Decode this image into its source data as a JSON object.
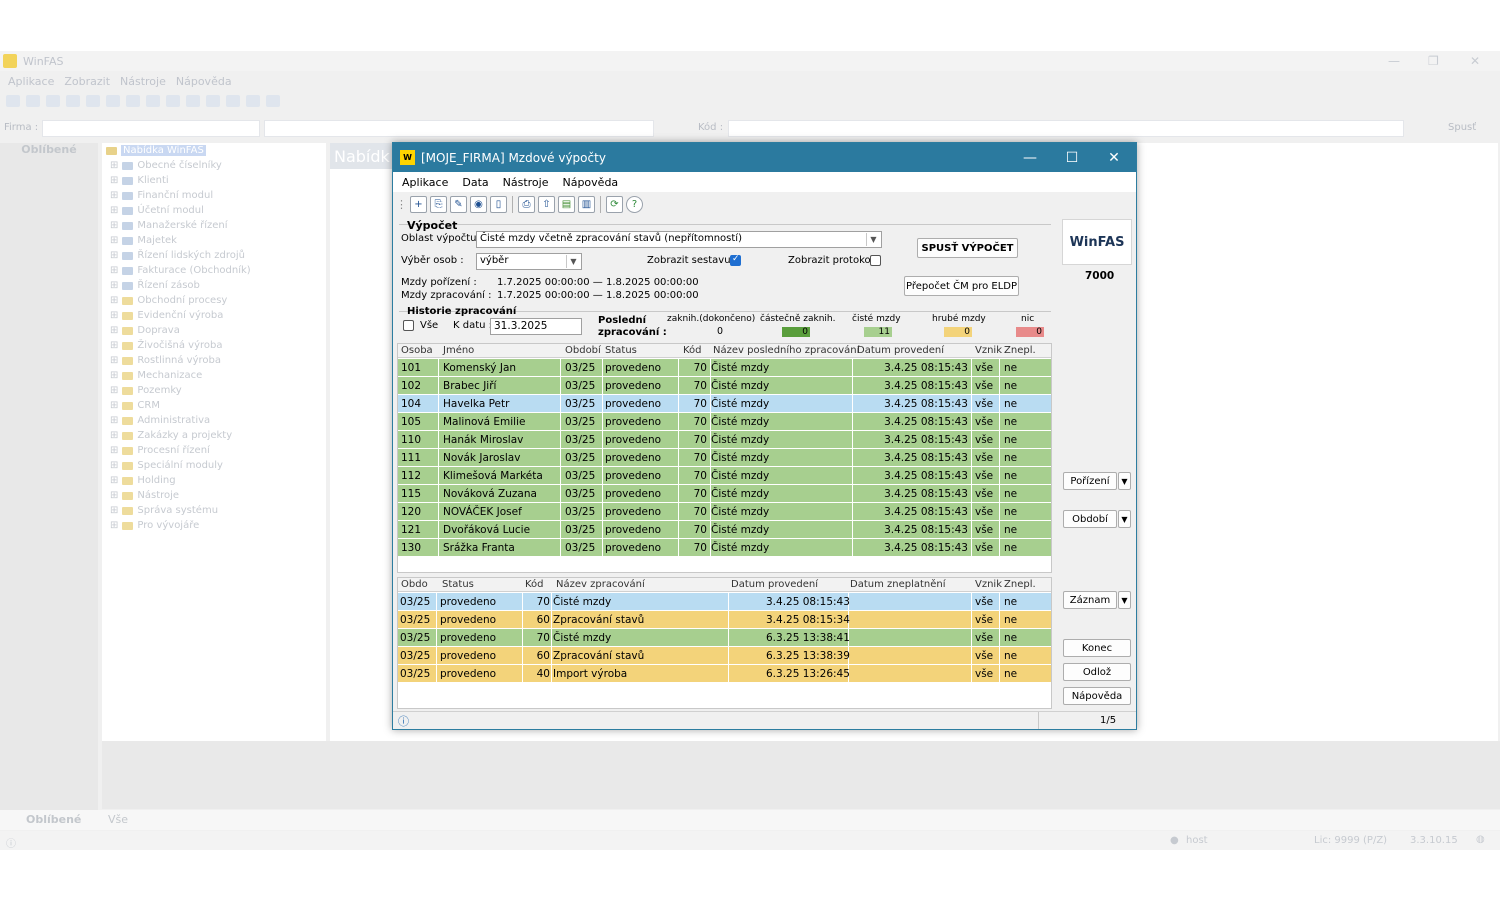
{
  "bg": {
    "title": "WinFAS",
    "menu": [
      "Aplikace",
      "Zobrazit",
      "Nástroje",
      "Nápověda"
    ],
    "firma_label": "Firma :",
    "kod_label": "Kód :",
    "spust": "Spusť",
    "left_tab": "Oblíbené",
    "main_tab": "Nabídk",
    "tree_root": "Nabídka WinFAS",
    "tree_items": [
      "Obecné číselníky",
      "Klienti",
      "Finanční modul",
      "Účetní modul",
      "Manažerské řízení",
      "Majetek",
      "Řízení lidských zdrojů",
      "Fakturace (Obchodník)",
      "Řízení zásob",
      "Obchodní procesy",
      "Evidenční výroba",
      "Doprava",
      "Živočišná výroba",
      "Rostlinná výroba",
      "Mechanizace",
      "Pozemky",
      "CRM",
      "Administrativa",
      "Zakázky a projekty",
      "Procesní řízení",
      "Speciální moduly",
      "Holding",
      "Nástroje",
      "Správa systému",
      "Pro vývojáře"
    ],
    "bottom_tab1": "Oblíbené",
    "bottom_tab2": "Vše",
    "status_user": "host",
    "status_lic": "Lic: 9999 (P/Z)",
    "status_ver": "3.3.10.15"
  },
  "dialog": {
    "title": "[MOJE_FIRMA] Mzdové výpočty",
    "menu": [
      "Aplikace",
      "Data",
      "Nástroje",
      "Nápověda"
    ],
    "vypocet": {
      "group": "Výpočet",
      "oblast_label": "Oblast výpočtu",
      "oblast_value": "Čisté mzdy včetně zpracování stavů (nepřítomností)",
      "vyber_label": "Výběr osob :",
      "vyber_value": "výběr",
      "sestava_label": "Zobrazit sestavu :",
      "protokol_label": "Zobrazit protokol :",
      "porizeni_label": "Mzdy pořízení :",
      "porizeni_value": "1.7.2025 00:00:00  —  1.8.2025 00:00:00",
      "zprac_label": "Mzdy zpracování :",
      "zprac_value": "1.7.2025 00:00:00  —  1.8.2025 00:00:00",
      "spust_btn": "SPUSŤ VÝPOČET",
      "prepocet_btn": "Přepočet ČM pro ELDP"
    },
    "historie": {
      "group": "Historie zpracování",
      "vse": "Vše",
      "kdatu_label": "K datu :",
      "kdatu_value": "31.3.2025",
      "posledni": "Poslední",
      "zpracovani": "zpracování :",
      "stats": [
        {
          "label": "zaknih.(dokončeno)",
          "value": "0",
          "color": "#f0f0f0"
        },
        {
          "label": "částečně zaknih.",
          "value": "0",
          "color": "#5a9e3c"
        },
        {
          "label": "čisté mzdy",
          "value": "11",
          "color": "#a7cf8f"
        },
        {
          "label": "hrubé mzdy",
          "value": "0",
          "color": "#f3d37a"
        },
        {
          "label": "nic",
          "value": "0",
          "color": "#e88a8a"
        }
      ]
    },
    "grid1": {
      "headers": [
        "Osoba",
        "Jméno",
        "Období",
        "Status",
        "Kód",
        "Název posledního zpracování",
        "Datum provedení",
        "Vznik",
        "Znepl."
      ],
      "rows": [
        [
          "101",
          "Komenský Jan",
          "03/25",
          "provedeno",
          "70",
          "Čisté mzdy",
          "3.4.25 08:15:43",
          "vše",
          "ne"
        ],
        [
          "102",
          "Brabec Jiří",
          "03/25",
          "provedeno",
          "70",
          "Čisté mzdy",
          "3.4.25 08:15:43",
          "vše",
          "ne"
        ],
        [
          "104",
          "Havelka Petr",
          "03/25",
          "provedeno",
          "70",
          "Čisté mzdy",
          "3.4.25 08:15:43",
          "vše",
          "ne"
        ],
        [
          "105",
          "Malinová Emilie",
          "03/25",
          "provedeno",
          "70",
          "Čisté mzdy",
          "3.4.25 08:15:43",
          "vše",
          "ne"
        ],
        [
          "110",
          "Hanák Miroslav",
          "03/25",
          "provedeno",
          "70",
          "Čisté mzdy",
          "3.4.25 08:15:43",
          "vše",
          "ne"
        ],
        [
          "111",
          "Novák Jaroslav",
          "03/25",
          "provedeno",
          "70",
          "Čisté mzdy",
          "3.4.25 08:15:43",
          "vše",
          "ne"
        ],
        [
          "112",
          "Klimešová Markéta",
          "03/25",
          "provedeno",
          "70",
          "Čisté mzdy",
          "3.4.25 08:15:43",
          "vše",
          "ne"
        ],
        [
          "115",
          "Nováková  Zuzana",
          "03/25",
          "provedeno",
          "70",
          "Čisté mzdy",
          "3.4.25 08:15:43",
          "vše",
          "ne"
        ],
        [
          "120",
          "NOVÁČEK Josef",
          "03/25",
          "provedeno",
          "70",
          "Čisté mzdy",
          "3.4.25 08:15:43",
          "vše",
          "ne"
        ],
        [
          "121",
          "Dvořáková Lucie",
          "03/25",
          "provedeno",
          "70",
          "Čisté mzdy",
          "3.4.25 08:15:43",
          "vše",
          "ne"
        ],
        [
          "130",
          "Srážka Franta",
          "03/25",
          "provedeno",
          "70",
          "Čisté mzdy",
          "3.4.25 08:15:43",
          "vše",
          "ne"
        ]
      ],
      "selected": 2
    },
    "grid2": {
      "headers": [
        "Obdo",
        "Status",
        "Kód",
        "Název zpracování",
        "Datum provedení",
        "Datum zneplatnění",
        "Vznik",
        "Znepl."
      ],
      "rows": [
        [
          "03/25",
          "provedeno",
          "70",
          "Čisté mzdy",
          "3.4.25 08:15:43",
          "",
          "vše",
          "ne"
        ],
        [
          "03/25",
          "provedeno",
          "60",
          "Zpracování stavů",
          "3.4.25 08:15:34",
          "",
          "vše",
          "ne"
        ],
        [
          "03/25",
          "provedeno",
          "70",
          "Čisté mzdy",
          "6.3.25 13:38:41",
          "",
          "vše",
          "ne"
        ],
        [
          "03/25",
          "provedeno",
          "60",
          "Zpracování stavů",
          "6.3.25 13:38:39",
          "",
          "vše",
          "ne"
        ],
        [
          "03/25",
          "provedeno",
          "40",
          "Import výroba",
          "6.3.25 13:26:45",
          "",
          "vše",
          "ne"
        ]
      ],
      "row_colors": [
        "#b9dcf2",
        "#f3d37a",
        "#a7cf8f",
        "#f3d37a",
        "#f3d37a"
      ]
    },
    "right": {
      "logo": "WinFAS",
      "code": "7000",
      "porizeni": "Pořízení",
      "obdobi": "Období",
      "zaznam": "Záznam",
      "konec": "Konec",
      "odloz": "Odlož",
      "napoveda": "Nápověda"
    },
    "status_page": "1/5"
  }
}
